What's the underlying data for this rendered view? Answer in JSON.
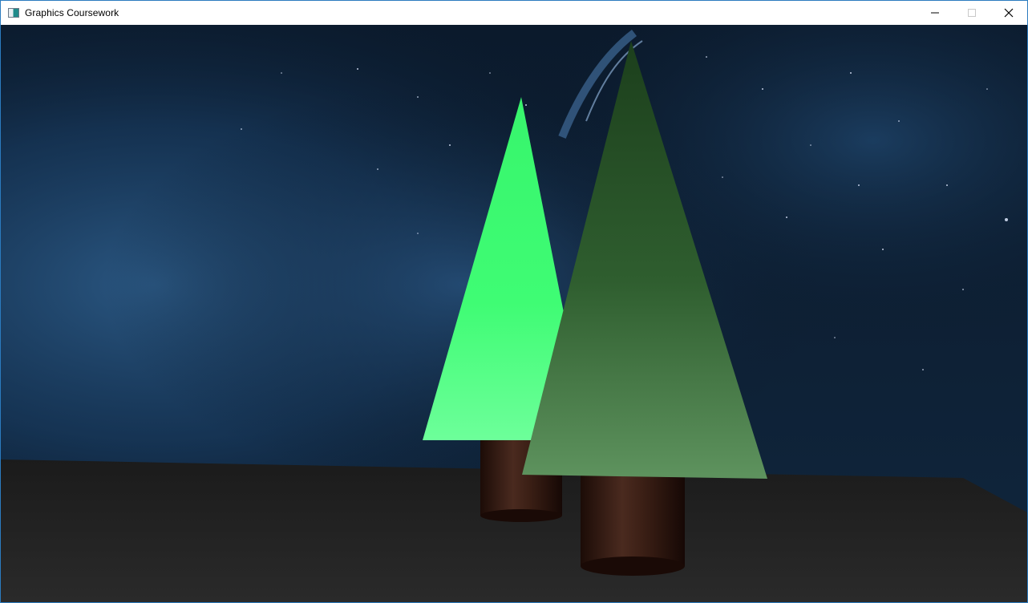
{
  "window": {
    "title": "Graphics Coursework",
    "app_icon": "app-window-icon",
    "controls": {
      "minimize_icon": "minimize-icon",
      "maximize_icon": "maximize-icon",
      "close_icon": "close-icon",
      "maximize_enabled": false
    }
  },
  "scene": {
    "background": "starry-night-nebula",
    "ground_color": "#222222",
    "trees": [
      {
        "name": "back-tree",
        "foliage_color": "#3dfa70",
        "trunk_color": "#3a1d14"
      },
      {
        "name": "front-tree",
        "foliage_color": "#2f6e2f",
        "trunk_color": "#3a1d14"
      }
    ]
  }
}
